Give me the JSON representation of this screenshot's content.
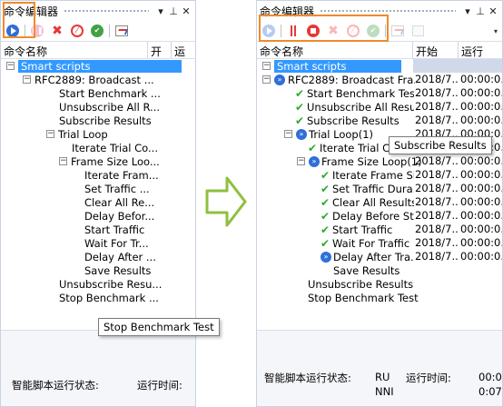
{
  "colors": {
    "accent_orange": "#f08a2c",
    "selection_blue": "#3399ff",
    "run_blue": "#2f6fd6",
    "stop_red": "#e53935",
    "check_green": "#2eaa2e",
    "arrow_green": "#8fbf3f"
  },
  "left": {
    "title": "命令编辑器",
    "title_controls": [
      "▾",
      "⊥",
      "✕"
    ],
    "toolbar_icons": [
      "play-icon",
      "pause-icon",
      "stop-icon",
      "delete-icon",
      "forbid-icon",
      "check-icon",
      "chart-icon"
    ],
    "columns": [
      "命令名称",
      "开",
      "运"
    ],
    "tree": [
      {
        "label": "Smart scripts",
        "selected": true
      },
      {
        "label": "RFC2889: Broadcast ..."
      },
      {
        "label": "Start Benchmark ..."
      },
      {
        "label": "Unsubscribe All R..."
      },
      {
        "label": "Subscribe Results"
      },
      {
        "label": "Trial Loop"
      },
      {
        "label": "Iterate Trial Co..."
      },
      {
        "label": "Frame Size Loo..."
      },
      {
        "label": "Iterate Fram..."
      },
      {
        "label": "Set Traffic ..."
      },
      {
        "label": "Clear All Re..."
      },
      {
        "label": "Delay Befor..."
      },
      {
        "label": "Start Traffic"
      },
      {
        "label": "Wait For Tr..."
      },
      {
        "label": "Delay After ..."
      },
      {
        "label": "Save Results"
      },
      {
        "label": "Unsubscribe Resu..."
      },
      {
        "label": "Stop Benchmark ..."
      }
    ],
    "tooltip": "Stop Benchmark Test",
    "status_label": "智能脚本运行状态:",
    "time_label": "运行时间:"
  },
  "right": {
    "title": "命令编辑器",
    "title_controls": [
      "▾",
      "⊥",
      "✕"
    ],
    "toolbar_icons": [
      "play-icon",
      "pause-icon",
      "stop-icon",
      "delete-icon",
      "forbid-icon",
      "check-icon",
      "chart-icon",
      "config-icon"
    ],
    "columns": [
      "命令名称",
      "开始",
      "运行"
    ],
    "tree": [
      {
        "label": "Smart scripts",
        "start": "",
        "run": "",
        "selected": true
      },
      {
        "label": "RFC2889: Broadcast Fra...",
        "start": "2018/7...",
        "run": "00:00:0..."
      },
      {
        "label": "Start Benchmark Test",
        "start": "2018/7...",
        "run": "00:00:0..."
      },
      {
        "label": "Unsubscribe All Resul...",
        "start": "2018/7...",
        "run": "00:00:0..."
      },
      {
        "label": "Subscribe Results",
        "start": "2018/7...",
        "run": "00:00:0..."
      },
      {
        "label": "Trial Loop(1)",
        "start": "2018/7...",
        "run": "00:00:0..."
      },
      {
        "label": "Iterate Trial Co",
        "start": "",
        "run": "00:00:0..."
      },
      {
        "label": "Frame Size Loop(1)",
        "start": "2018/7...",
        "run": "00:00:0..."
      },
      {
        "label": "Iterate Frame Si...",
        "start": "2018/7...",
        "run": "00:00:0..."
      },
      {
        "label": "Set Traffic Dura...",
        "start": "2018/7...",
        "run": "00:00:0..."
      },
      {
        "label": "Clear All Results",
        "start": "2018/7...",
        "run": "00:00:0..."
      },
      {
        "label": "Delay Before St...",
        "start": "2018/7...",
        "run": "00:00:0..."
      },
      {
        "label": "Start Traffic",
        "start": "2018/7...",
        "run": "00:00:0..."
      },
      {
        "label": "Wait For Traffic ...",
        "start": "2018/7...",
        "run": "00:00:0..."
      },
      {
        "label": "Delay After Tra...",
        "start": "2018/7...",
        "run": "00:00:0..."
      },
      {
        "label": "Save Results",
        "start": "",
        "run": ""
      },
      {
        "label": "Unsubscribe Results",
        "start": "",
        "run": ""
      },
      {
        "label": "Stop Benchmark Test",
        "start": "",
        "run": ""
      }
    ],
    "tooltip": "Subscribe Results",
    "status_label": "智能脚本运行状态:",
    "status_value_1": "RU",
    "status_value_2": "NNI",
    "time_label": "运行时间:",
    "time_value_1": "00:0",
    "time_value_2": "0:07"
  }
}
